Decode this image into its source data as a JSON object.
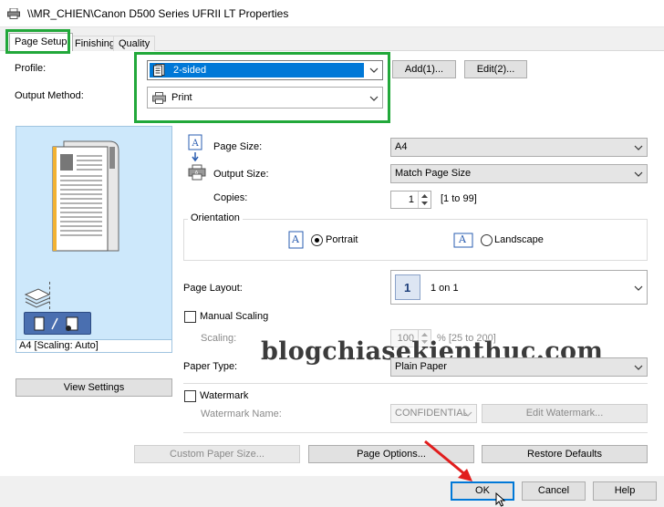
{
  "window": {
    "title": "\\\\MR_CHIEN\\Canon D500 Series UFRII LT Properties"
  },
  "tabs": [
    {
      "label": "Page Setup"
    },
    {
      "label": "Finishing"
    },
    {
      "label": "Quality"
    }
  ],
  "profile": {
    "label": "Profile:",
    "value": "2-sided",
    "add_label": "Add(1)...",
    "edit_label": "Edit(2)..."
  },
  "output_method": {
    "label": "Output Method:",
    "value": "Print"
  },
  "preview": {
    "caption": "A4 [Scaling: Auto]",
    "view_settings_label": "View Settings"
  },
  "page_size": {
    "label": "Page Size:",
    "value": "A4"
  },
  "output_size": {
    "label": "Output Size:",
    "value": "Match Page Size"
  },
  "copies": {
    "label": "Copies:",
    "value": "1",
    "range": "[1 to 99]"
  },
  "orientation": {
    "label": "Orientation",
    "portrait": "Portrait",
    "landscape": "Landscape",
    "icon_letter": "A"
  },
  "page_layout": {
    "label": "Page Layout:",
    "value": "1 on 1",
    "icon_number": "1"
  },
  "manual_scaling": {
    "label": "Manual Scaling",
    "scaling_label": "Scaling:",
    "scaling_value": "100",
    "scaling_range": "% [25 to 200]"
  },
  "paper_type": {
    "label": "Paper Type:",
    "value": "Plain Paper"
  },
  "watermark": {
    "label": "Watermark",
    "name_label": "Watermark Name:",
    "name_value": "CONFIDENTIAL",
    "edit_label": "Edit Watermark..."
  },
  "buttons": {
    "custom_paper_size": "Custom Paper Size...",
    "page_options": "Page Options...",
    "restore_defaults": "Restore Defaults",
    "ok": "OK",
    "cancel": "Cancel",
    "help": "Help"
  },
  "overlay_watermark": "blogchiasekienthuc.com",
  "colors": {
    "highlight_green": "#22a83a",
    "selection_blue": "#0078d7",
    "preview_blue": "#cde8fb",
    "arrow_red": "#e11d1d"
  }
}
